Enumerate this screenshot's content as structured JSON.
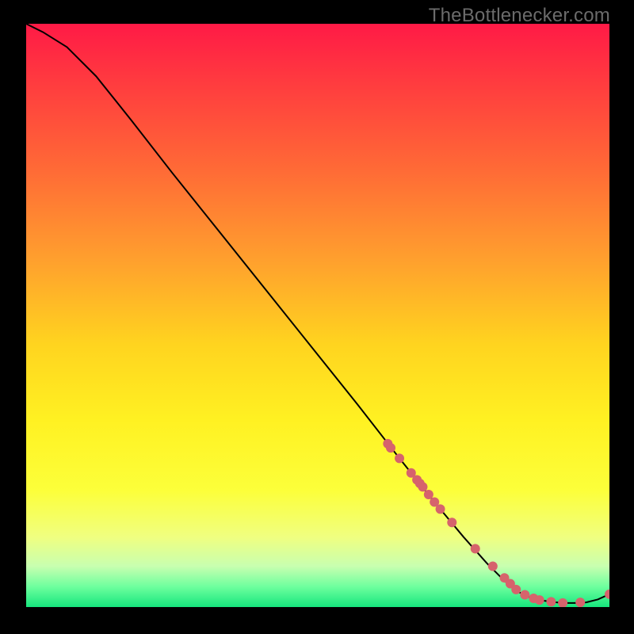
{
  "watermark": "TheBottlenecker.com",
  "chart_data": {
    "type": "line",
    "title": "",
    "xlabel": "",
    "ylabel": "",
    "xlim": [
      0,
      100
    ],
    "ylim": [
      0,
      100
    ],
    "grid": false,
    "background_gradient_stops": [
      {
        "offset": 0.0,
        "color": "#ff1a46"
      },
      {
        "offset": 0.1,
        "color": "#ff3b3f"
      },
      {
        "offset": 0.25,
        "color": "#ff6a36"
      },
      {
        "offset": 0.4,
        "color": "#ff9e2e"
      },
      {
        "offset": 0.55,
        "color": "#ffd41f"
      },
      {
        "offset": 0.68,
        "color": "#fff122"
      },
      {
        "offset": 0.8,
        "color": "#fcff3a"
      },
      {
        "offset": 0.88,
        "color": "#f0ff80"
      },
      {
        "offset": 0.93,
        "color": "#c8ffb0"
      },
      {
        "offset": 0.965,
        "color": "#6eff9e"
      },
      {
        "offset": 1.0,
        "color": "#16e67d"
      }
    ],
    "series": [
      {
        "name": "curve",
        "type": "line",
        "color": "#000000",
        "x": [
          0,
          3,
          7,
          12,
          18,
          25,
          33,
          41,
          49,
          57,
          64,
          70,
          75,
          79,
          82,
          84,
          86,
          88,
          90,
          92,
          94,
          96,
          98,
          100
        ],
        "y": [
          100,
          98.5,
          96,
          91,
          83.5,
          74.5,
          64.5,
          54.5,
          44.5,
          34.5,
          25.5,
          18,
          12,
          7.5,
          4.5,
          2.8,
          1.8,
          1.2,
          0.9,
          0.7,
          0.7,
          0.8,
          1.3,
          2.2
        ]
      },
      {
        "name": "points",
        "type": "scatter",
        "color": "#d6636c",
        "x": [
          62,
          62.5,
          64,
          66,
          67,
          67.5,
          68,
          69,
          70,
          71,
          73,
          77,
          80,
          82,
          83,
          84,
          85.5,
          87,
          88,
          90,
          92,
          95,
          100
        ],
        "y": [
          28,
          27.3,
          25.5,
          23,
          21.8,
          21.2,
          20.6,
          19.3,
          18,
          16.8,
          14.5,
          10,
          7,
          5,
          4,
          3,
          2.1,
          1.5,
          1.2,
          0.9,
          0.7,
          0.8,
          2.2
        ]
      }
    ]
  }
}
